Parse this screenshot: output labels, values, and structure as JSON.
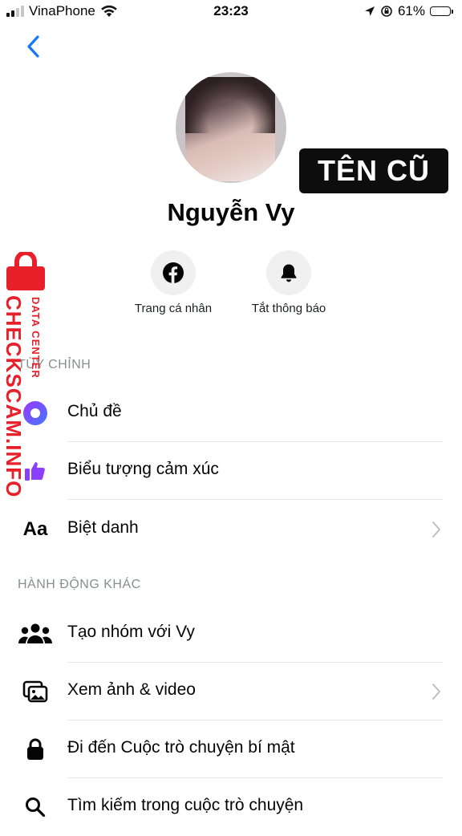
{
  "status_bar": {
    "carrier": "VinaPhone",
    "time": "23:23",
    "battery": "61%",
    "battery_level": 0.61
  },
  "profile": {
    "name": "Nguyễn Vy",
    "overlay_badge": "TÊN CŨ"
  },
  "quick_actions": [
    {
      "label": "Trang cá nhân",
      "icon": "facebook-icon"
    },
    {
      "label": "Tắt thông báo",
      "icon": "bell-icon"
    }
  ],
  "sections": {
    "customize": {
      "title": "TÙY CHỈNH",
      "items": [
        {
          "label": "Chủ đề",
          "icon": "theme-icon"
        },
        {
          "label": "Biểu tượng cảm xúc",
          "icon": "thumbs-up-icon"
        },
        {
          "label": "Biệt danh",
          "icon": "nickname-aa-icon",
          "icon_text": "Aa",
          "chevron": true
        }
      ]
    },
    "other_actions": {
      "title": "HÀNH ĐỘNG KHÁC",
      "items": [
        {
          "label": "Tạo nhóm với Vy",
          "icon": "group-icon"
        },
        {
          "label": "Xem ảnh & video",
          "icon": "photos-icon",
          "chevron": true
        },
        {
          "label": "Đi đến Cuộc trò chuyện bí mật",
          "icon": "lock-icon"
        },
        {
          "label": "Tìm kiếm trong cuộc trò chuyện",
          "icon": "search-icon"
        }
      ]
    }
  },
  "watermark": {
    "brand": "CHECKSCAM.INFO",
    "sub": "DATA CENTER"
  },
  "colors": {
    "accent": "#1877f2",
    "theme": "#6e5cf6",
    "watermark": "#e8202a"
  }
}
